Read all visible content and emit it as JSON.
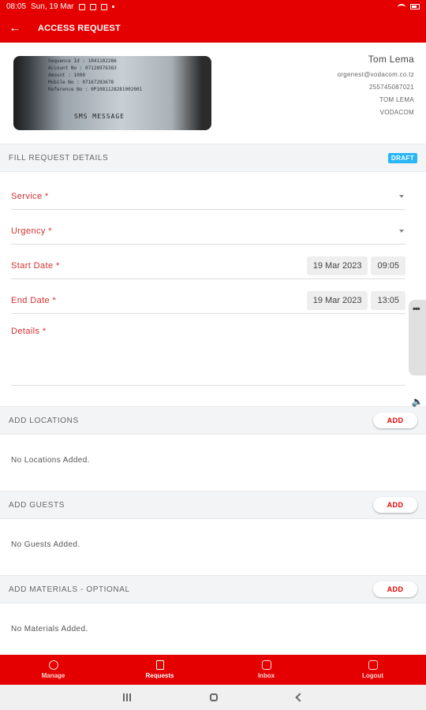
{
  "status_bar": {
    "time": "08:05",
    "date": "Sun, 19 Mar"
  },
  "app_bar": {
    "title": "ACCESS REQUEST"
  },
  "profile": {
    "image_caption": "SMS MESSAGE",
    "image_lines": [
      "Sequence Id    : 1041102286",
      "Account No     : 07128976383",
      "Amount         : 1000",
      "Mobile No      : 07167283678",
      "Reference No   : 0P1081128281002001"
    ],
    "name": "Tom Lema",
    "email": "orgenest@vodacom.co.tz",
    "phone": "255745087021",
    "display_name": "TOM LEMA",
    "company": "VODACOM"
  },
  "request_details": {
    "header": "FILL REQUEST DETAILS",
    "status_badge": "DRAFT",
    "service_label": "Service *",
    "urgency_label": "Urgency *",
    "start_label": "Start Date *",
    "start_date": "19 Mar 2023",
    "start_time": "09:05",
    "end_label": "End Date *",
    "end_date": "19 Mar 2023",
    "end_time": "13:05",
    "details_label": "Details *"
  },
  "locations": {
    "header": "ADD LOCATIONS",
    "add_label": "ADD",
    "empty_text": "No Locations Added."
  },
  "guests": {
    "header": "ADD GUESTS",
    "add_label": "ADD",
    "empty_text": "No Guests Added."
  },
  "materials": {
    "header": "ADD MATERIALS - OPTIONAL",
    "add_label": "ADD",
    "empty_text": "No Materials Added."
  },
  "bottom_nav": [
    {
      "label": "Manage",
      "icon": "gear-icon"
    },
    {
      "label": "Requests",
      "icon": "document-icon",
      "active": true
    },
    {
      "label": "Inbox",
      "icon": "inbox-icon"
    },
    {
      "label": "Logout",
      "icon": "logout-icon"
    }
  ],
  "colors": {
    "brand_red": "#e40000",
    "label_red": "#d32f2f",
    "draft_blue": "#29b6f6"
  }
}
